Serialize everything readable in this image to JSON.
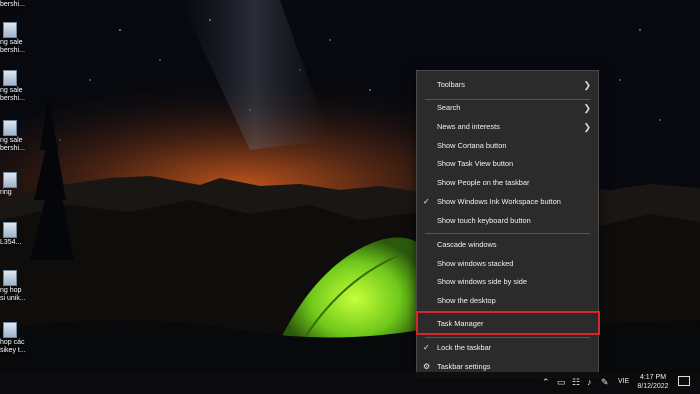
{
  "desktop": {
    "icons": [
      {
        "caption": "bershi..."
      },
      {
        "caption": "ng sale\nbershi..."
      },
      {
        "caption": "ng sale\nbershi..."
      },
      {
        "caption": "ng sale\nbershi..."
      },
      {
        "caption": "ring"
      },
      {
        "caption": "L354..."
      },
      {
        "caption": "ng hop\nsi unik..."
      },
      {
        "caption": "hop các\nsikey t..."
      }
    ]
  },
  "context_menu": {
    "items": [
      {
        "label": "Toolbars",
        "submenu": true,
        "checked": false
      },
      {
        "label": "Search",
        "submenu": true,
        "checked": false
      },
      {
        "label": "News and interests",
        "submenu": true,
        "checked": false
      },
      {
        "label": "Show Cortana button",
        "submenu": false,
        "checked": false
      },
      {
        "label": "Show Task View button",
        "submenu": false,
        "checked": false
      },
      {
        "label": "Show People on the taskbar",
        "submenu": false,
        "checked": false
      },
      {
        "label": "Show Windows Ink Workspace button",
        "submenu": false,
        "checked": true
      },
      {
        "label": "Show touch keyboard button",
        "submenu": false,
        "checked": false
      },
      {
        "label": "Cascade windows",
        "submenu": false,
        "checked": false
      },
      {
        "label": "Show windows stacked",
        "submenu": false,
        "checked": false
      },
      {
        "label": "Show windows side by side",
        "submenu": false,
        "checked": false
      },
      {
        "label": "Show the desktop",
        "submenu": false,
        "checked": false
      },
      {
        "label": "Task Manager",
        "submenu": false,
        "checked": false,
        "highlighted": true
      },
      {
        "label": "Lock the taskbar",
        "submenu": false,
        "checked": true
      },
      {
        "label": "Taskbar settings",
        "submenu": false,
        "checked": false,
        "icon": "gear-icon"
      }
    ],
    "highlight_color": "#d6262b"
  },
  "taskbar": {
    "tray_icons": [
      "chevron-up-icon",
      "monitor-icon",
      "network-icon",
      "volume-icon",
      "pen-icon"
    ],
    "language": "VIE",
    "time": "4:17 PM",
    "date": "8/12/2022",
    "notification_icon": "action-center-icon"
  }
}
